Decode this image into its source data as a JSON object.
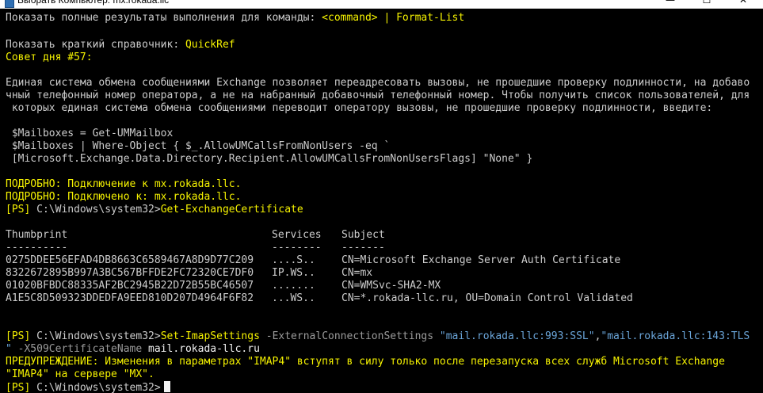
{
  "window": {
    "title": "Выбрать Компьютер: mx.rokada.llc",
    "minimize_glyph": "—",
    "maximize_glyph": "☐",
    "close_glyph": "✕"
  },
  "colors": {
    "background": "#000000",
    "text": "#cccccc",
    "highlight": "#f5f200",
    "parameter": "#9b9b9b",
    "string": "#6aa5d9"
  },
  "terminal": {
    "line1": {
      "a": "Показать полные результаты выполнения для команды: ",
      "b": "<command> | Format-List"
    },
    "line2": {
      "a": "Показать краткий справочник: ",
      "b": "QuickRef"
    },
    "tip_header": "Совет дня #57:",
    "tip_p1": "Единая система обмена сообщениями Exchange позволяет переадресовать вызовы, не прошедшие проверку подлинности, на добаво",
    "tip_p2": "чный телефонный номер оператора, а не на набранный добавочный телефонный номер. Чтобы получить список пользователей, для",
    "tip_p3": " которых единая система обмена сообщениями переводит оператору вызовы, не прошедшие проверку подлинности, введите:",
    "code1": " $Mailboxes = Get-UMMailbox",
    "code2": " $Mailboxes | Where-Object { $_.AllowUMCallsFromNonUsers -eq `",
    "code3": " [Microsoft.Exchange.Data.Directory.Recipient.AllowUMCallsFromNonUsersFlags] \"None\" }",
    "verbose1": "ПОДРОБНО: Подключение к mx.rokada.llc.",
    "verbose2": "ПОДРОБНО: Подключено к: mx.rokada.llc.",
    "prompt1": {
      "prefix": "[PS] ",
      "path": "C:\\Windows\\system32>",
      "command": "Get-ExchangeCertificate"
    },
    "table": {
      "headers": {
        "thumbprint": "Thumbprint",
        "services": "Services",
        "subject": "Subject"
      },
      "dashes": {
        "thumbprint": "----------",
        "services": "--------",
        "subject": "-------"
      },
      "rows": [
        {
          "thumbprint": "0275DDEE56EFAD4DB8663C6589467A8D9D77C209",
          "services": "....S..",
          "subject": "CN=Microsoft Exchange Server Auth Certificate"
        },
        {
          "thumbprint": "8322672895B997A3BC567BFFDE2FC72320CE7DF0",
          "services": "IP.WS..",
          "subject": "CN=mx"
        },
        {
          "thumbprint": "01020BFBDC88335AF2BC2945B22D72B55BC46507",
          "services": ".......",
          "subject": "CN=WMSvc-SHA2-MX"
        },
        {
          "thumbprint": "A1E5C8D509323DDEDFA9EED810D207D4964F6F82",
          "services": "...WS..",
          "subject": "CN=*.rokada-llc.ru, OU=Domain Control Validated"
        }
      ]
    },
    "prompt2": {
      "prefix": "[PS] ",
      "path": "C:\\Windows\\system32>",
      "command": "Set-ImapSettings",
      "param1": " -ExternalConnectionSettings ",
      "value1": "\"mail.rokada.llc:993:SSL\"",
      "comma": ",",
      "value2": "\"mail.rokada.llc:143:TLS",
      "cont_quote": "\"",
      "param2": " -X509CertificateName ",
      "value3": "mail.rokada-llc.ru"
    },
    "warning1": "ПРЕДУПРЕЖДЕНИЕ: Изменения в параметрах \"IMAP4\" вступят в силу только после перезапуска всех служб Microsoft Exchange",
    "warning2": "\"IMAP4\" на сервере \"MX\".",
    "prompt3": {
      "prefix": "[PS] ",
      "path": "C:\\Windows\\system32>"
    }
  }
}
